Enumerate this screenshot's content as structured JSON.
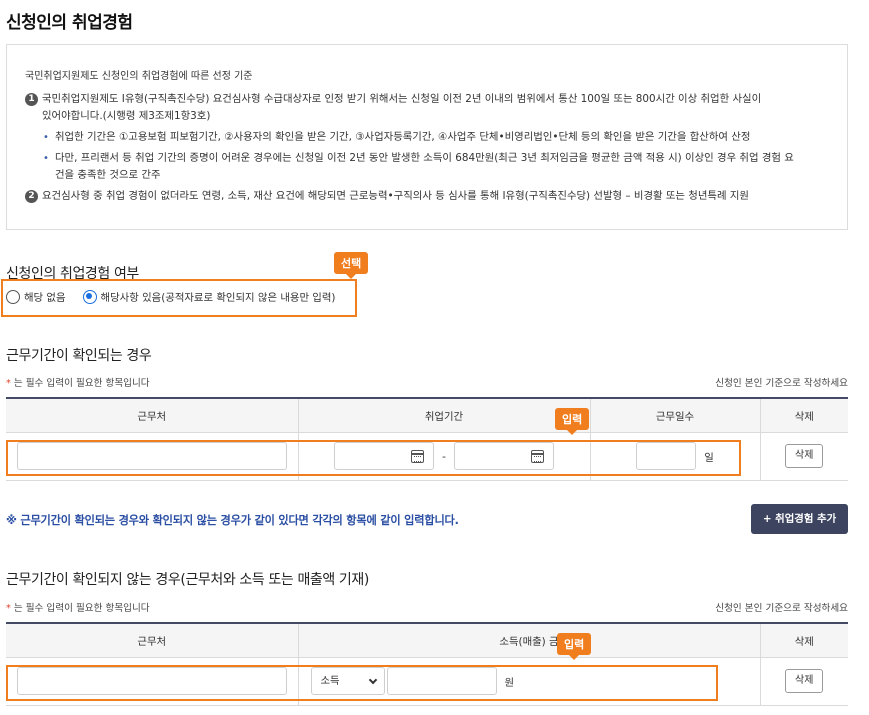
{
  "page": {
    "title": "신청인의 취업경험"
  },
  "info": {
    "heading": "국민취업지원제도 신청인의 취업경험에 따른 선정 기준",
    "item1_num": "1",
    "item1_line1": "국민취업지원제도 I유형(구직촉진수당) 요건심사형 수급대상자로 인정 받기 위해서는 신청일 이전 2년 이내의 범위에서 통산 100일 또는 800시간 이상 취업한 사실이",
    "item1_line2": "있어야합니다.(시행령 제3조제1항3호)",
    "bullet1": "취업한 기간은 ①고용보험 피보험기간, ②사용자의 확인을 받은 기간, ③사업자등록기간, ④사업주 단체•비영리법인•단체 등의 확인을 받은 기간을 합산하여 산정",
    "bullet2_line1": "다만, 프리랜서 등 취업 기간의 증명이 어려운 경우에는 신청일 이전 2년 동안 발생한 소득이 684만원(최근 3년 최저임금을 평균한 금액 적용 시) 이상인 경우 취업 경험 요",
    "bullet2_line2": "건을 충족한 것으로 간주",
    "item2_num": "2",
    "item2_line": "요건심사형 중 취업 경험이 없더라도 연령, 소득, 재산 요건에 해당되면 근로능력•구직의사 등 심사를 통해 I유형(구직촉진수당) 선발형 – 비경활 또는 청년특례 지원"
  },
  "experience": {
    "label": "신청인의 취업경험 여부",
    "callout": "선택",
    "option_none": "해당 없음",
    "option_yes": "해당사항 있음(공적자료로 확인되지 않은 내용만 입력)",
    "selected": "option_yes"
  },
  "confirmed": {
    "title": "근무기간이 확인되는 경우",
    "required_star": "*",
    "required_note": "는 필수 입력이 필요한 항목입니다",
    "right_note": "신청인 본인 기준으로 작성하세요",
    "headers": [
      "근무처",
      "취업기간",
      "근무일수",
      "삭제"
    ],
    "callout": "입력",
    "date_separator": "-",
    "days_unit": "일",
    "delete_label": "삭제"
  },
  "notice": "※ 근무기간이 확인되는 경우와 확인되지 않는 경우가 같이 있다면 각각의 항목에 같이 입력합니다.",
  "add_button": "+ 취업경험 추가",
  "unconfirmed": {
    "title": "근무기간이 확인되지 않는 경우(근무처와 소득 또는 매출액 기재)",
    "required_star": "*",
    "required_note": "는 필수 입력이 필요한 항목입니다",
    "right_note": "신청인 본인 기준으로 작성하세요",
    "headers": [
      "근무처",
      "소득(매출) 금",
      "삭제"
    ],
    "callout": "입력",
    "select_value": "소득",
    "won_unit": "원",
    "delete_label": "삭제"
  },
  "colors": {
    "accent_orange": "#f07d1e",
    "navy": "#3d4460",
    "notice_blue": "#2a4ea3",
    "radio_blue": "#1a6fe0"
  },
  "icons": [
    "calendar-icon",
    "chevron-down-icon",
    "number-circle-icon"
  ]
}
